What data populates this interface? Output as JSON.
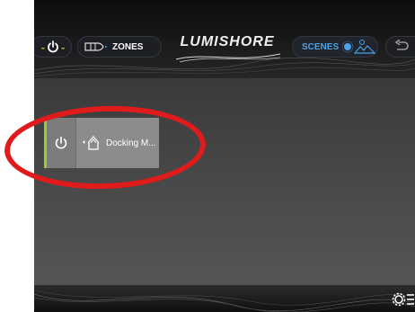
{
  "header": {
    "power_icon": "power-icon",
    "zones": {
      "label": "ZONES",
      "icon": "boat-zones-icon"
    },
    "logo": "LUMISHORE",
    "scenes": {
      "label": "SCENES",
      "icon": "mountain-scene-icon"
    },
    "back_icon": "back-arrow-icon"
  },
  "scene_tile": {
    "label": "Docking M...",
    "power_icon": "power-icon",
    "scene_icon": "docking-boat-icon",
    "active_color": "#9acd32"
  },
  "footer": {
    "settings_icon": "settings-menu-icon"
  },
  "colors": {
    "accent_blue": "#4aa3e6",
    "power_yellow": "#c9a227",
    "highlight_red": "#e01b1b"
  }
}
